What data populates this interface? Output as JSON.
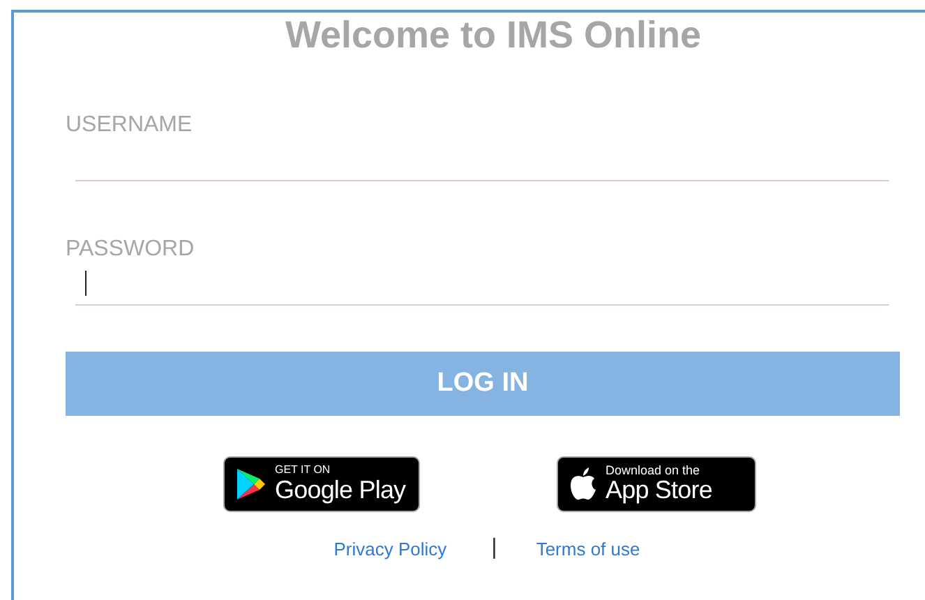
{
  "title": "Welcome to IMS Online",
  "fields": [
    {
      "label": "USERNAME",
      "focused": false
    },
    {
      "label": "PASSWORD",
      "focused": true
    }
  ],
  "login_button": "LOG IN",
  "store_badges": [
    {
      "kind": "google",
      "small": "GET IT ON",
      "big": "Google Play"
    },
    {
      "kind": "apple",
      "small": "Download on the",
      "big": "App Store"
    }
  ],
  "links": [
    "Privacy Policy",
    "Terms of use"
  ],
  "separator": "|"
}
